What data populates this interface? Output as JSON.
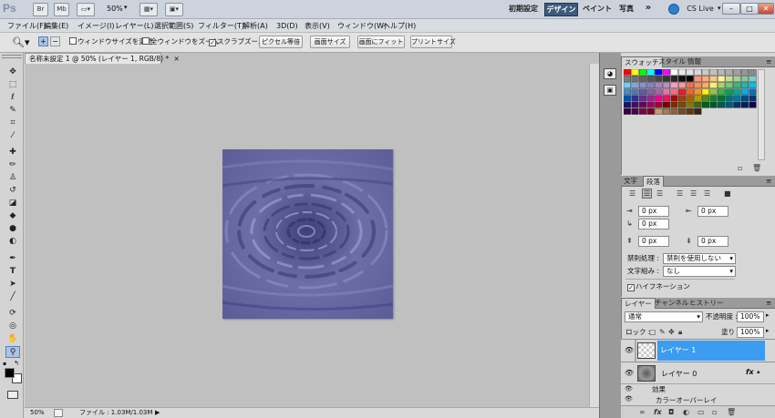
{
  "app": {
    "logo": "Ps",
    "bridge_label": "Br",
    "minibridge_label": "Mb",
    "zoom_value": "50%",
    "workspaces": [
      "初期設定",
      "デザイン",
      "ペイント",
      "写真"
    ],
    "more_label": "»",
    "cslive_label": "CS Live",
    "window_buttons": [
      "–",
      "□",
      "✕"
    ]
  },
  "menu": [
    "ファイル(F)",
    "編集(E)",
    "イメージ(I)",
    "レイヤー(L)",
    "選択範囲(S)",
    "フィルター(T)",
    "解析(A)",
    "3D(D)",
    "表示(V)",
    "ウィンドウ(W)",
    "ヘルプ(H)"
  ],
  "options": {
    "resize_windows_label": "ウィンドウサイズを変更",
    "resize_windows_checked": false,
    "zoom_all_label": "全ウィンドウをズーム",
    "zoom_all_checked": false,
    "scrubby_label": "スクラブズーム",
    "scrubby_checked": true,
    "actual_pixels": "ピクセル等倍",
    "fit_screen": "画面サイズ",
    "fill_screen": "画面にフィット",
    "print_size": "プリントサイズ"
  },
  "document": {
    "tab_title": "名称未設定 1 @ 50% (レイヤー 1, RGB/8) *",
    "zoom": "50%",
    "file_info": "ファイル : 1.03M/1.03M"
  },
  "swatches_panel": {
    "tabs": [
      "スウォッチ",
      "スタイル",
      "情報"
    ]
  },
  "paragraph_panel": {
    "tabs": [
      "文字",
      "段落"
    ],
    "indent_left": "0 px",
    "indent_right": "0 px",
    "indent_first": "0 px",
    "space_before": "0 px",
    "space_after": "0 px",
    "kinsoku_label": "禁則処理 :",
    "kinsoku_value": "禁則を使用しない",
    "mojikumi_label": "文字組み :",
    "mojikumi_value": "なし",
    "hyphenate_label": "ハイフネーション",
    "hyphenate_checked": true
  },
  "layers_panel": {
    "tabs": [
      "レイヤー",
      "チャンネル",
      "ヒストリー"
    ],
    "blend_mode": "通常",
    "opacity_label": "不透明度 :",
    "opacity": "100%",
    "lock_label": "ロック :",
    "fill_label": "塗り :",
    "fill": "100%",
    "layers": [
      {
        "name": "レイヤー 1",
        "selected": true
      },
      {
        "name": "レイヤー 0",
        "selected": false,
        "fx": "fx"
      }
    ],
    "effects_label": "効果",
    "effect_item": "カラーオーバーレイ"
  },
  "colors": {
    "selected_layer": "#3b9cf2",
    "canvas_base": "#6e6fa8"
  }
}
